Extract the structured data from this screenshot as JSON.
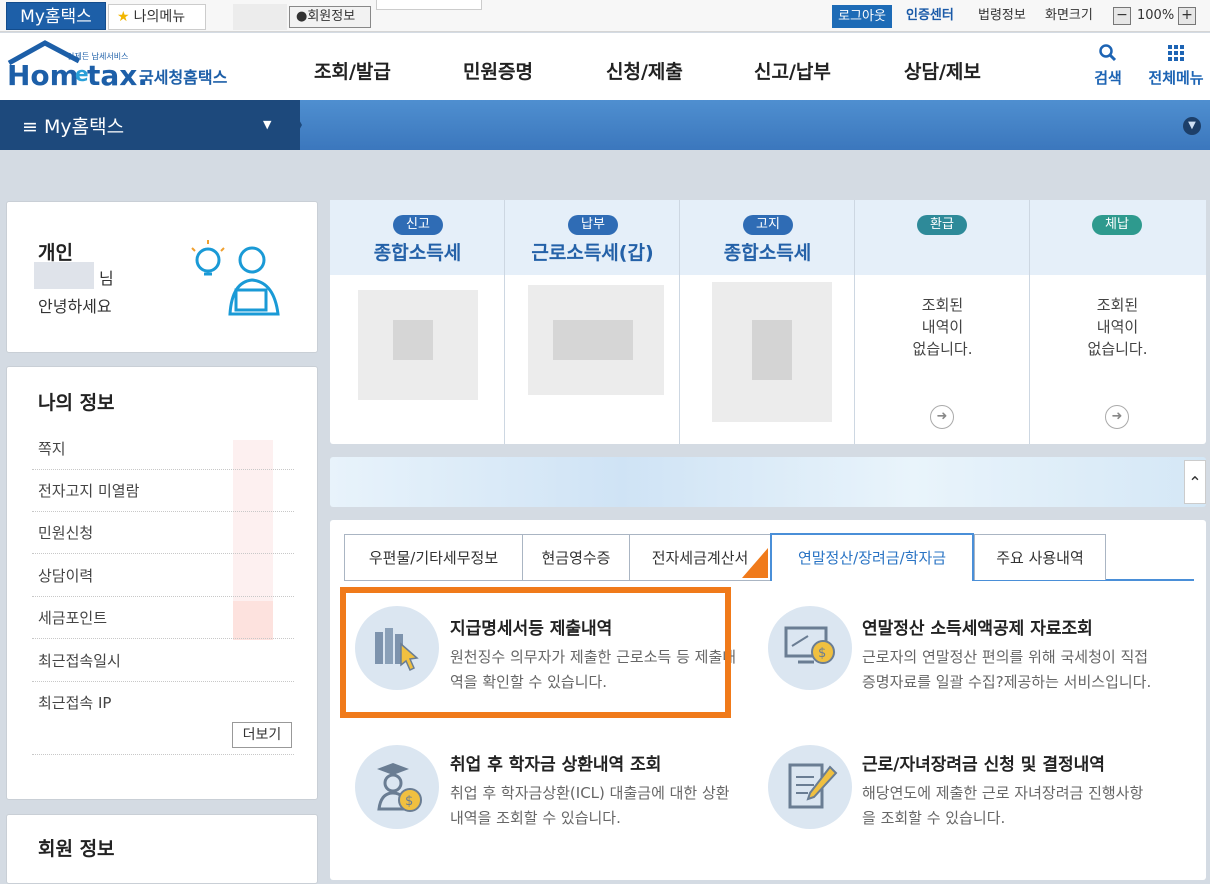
{
  "topbar": {
    "my_tab": "My홈택스",
    "fav_tab": "나의메뉴",
    "member_tab": "회원정보",
    "logout": "로그아웃",
    "cert": "인증센터",
    "law": "법령정보",
    "screen_size": "화면크기",
    "zoom": "100%",
    "zoom_minus": "−",
    "zoom_plus": "+"
  },
  "header": {
    "logo_small": "언제든 납세서비스",
    "logo_main": "Hometax.",
    "logo_sub": "국세청홈택스",
    "gnb": [
      "조회/발급",
      "민원증명",
      "신청/제출",
      "신고/납부",
      "상담/제보"
    ],
    "search": "검색",
    "all_menu": "전체메뉴"
  },
  "nav": {
    "title": "My홈택스"
  },
  "greeting": {
    "type": "개인",
    "suffix": "님",
    "hello": "안녕하세요"
  },
  "my_info": {
    "title": "나의 정보",
    "items": [
      "쪽지",
      "전자고지 미열람",
      "민원신청",
      "상담이력",
      "세금포인트",
      "최근접속일시",
      "최근접속 IP"
    ],
    "more": "더보기"
  },
  "member_info": {
    "title": "회원 정보"
  },
  "summary": {
    "cards": [
      {
        "badge": "신고",
        "name": "종합소득세",
        "empty": ""
      },
      {
        "badge": "납부",
        "name": "근로소득세(갑)",
        "empty": ""
      },
      {
        "badge": "고지",
        "name": "종합소득세",
        "empty": ""
      },
      {
        "badge": "환급",
        "name": "",
        "empty": "조회된\n내역이\n없습니다."
      },
      {
        "badge": "체납",
        "name": "",
        "empty": "조회된\n내역이\n없습니다."
      }
    ],
    "badge_colors": [
      "#2f6cb5",
      "#2f6cb5",
      "#2f6cb5",
      "#2e8a99",
      "#2e9a8e"
    ]
  },
  "tabs": {
    "items": [
      "우편물/기타세무정보",
      "현금영수증",
      "전자세금계산서",
      "연말정산/장려금/학자금",
      "주요 사용내역"
    ],
    "active_index": 3
  },
  "services": [
    {
      "title": "지급명세서등 제출내역",
      "desc": "원천징수 의무자가 제출한 근로소득 등 제출내역을 확인할 수 있습니다.",
      "icon": "books-cursor-icon"
    },
    {
      "title": "연말정산 소득세액공제 자료조회",
      "desc": "근로자의 연말정산 편의를 위해 국세청이 직접 증명자료를 일괄 수집?제공하는 서비스입니다.",
      "icon": "monitor-coin-icon"
    },
    {
      "title": "취업 후 학자금 상환내역 조회",
      "desc": "취업 후 학자금상환(ICL) 대출금에 대한 상환내역을 조회할 수 있습니다.",
      "icon": "graduate-coin-icon"
    },
    {
      "title": "근로/자녀장려금 신청 및 결정내역",
      "desc": "해당연도에 제출한 근로 자녀장려금 진행사항을 조회할 수 있습니다.",
      "icon": "document-pen-icon"
    }
  ],
  "colors": {
    "brand_blue": "#1d5fa8",
    "nav_dark": "#1d497c",
    "highlight_orange": "#f07a1a",
    "active_tab": "#2a74c4"
  }
}
